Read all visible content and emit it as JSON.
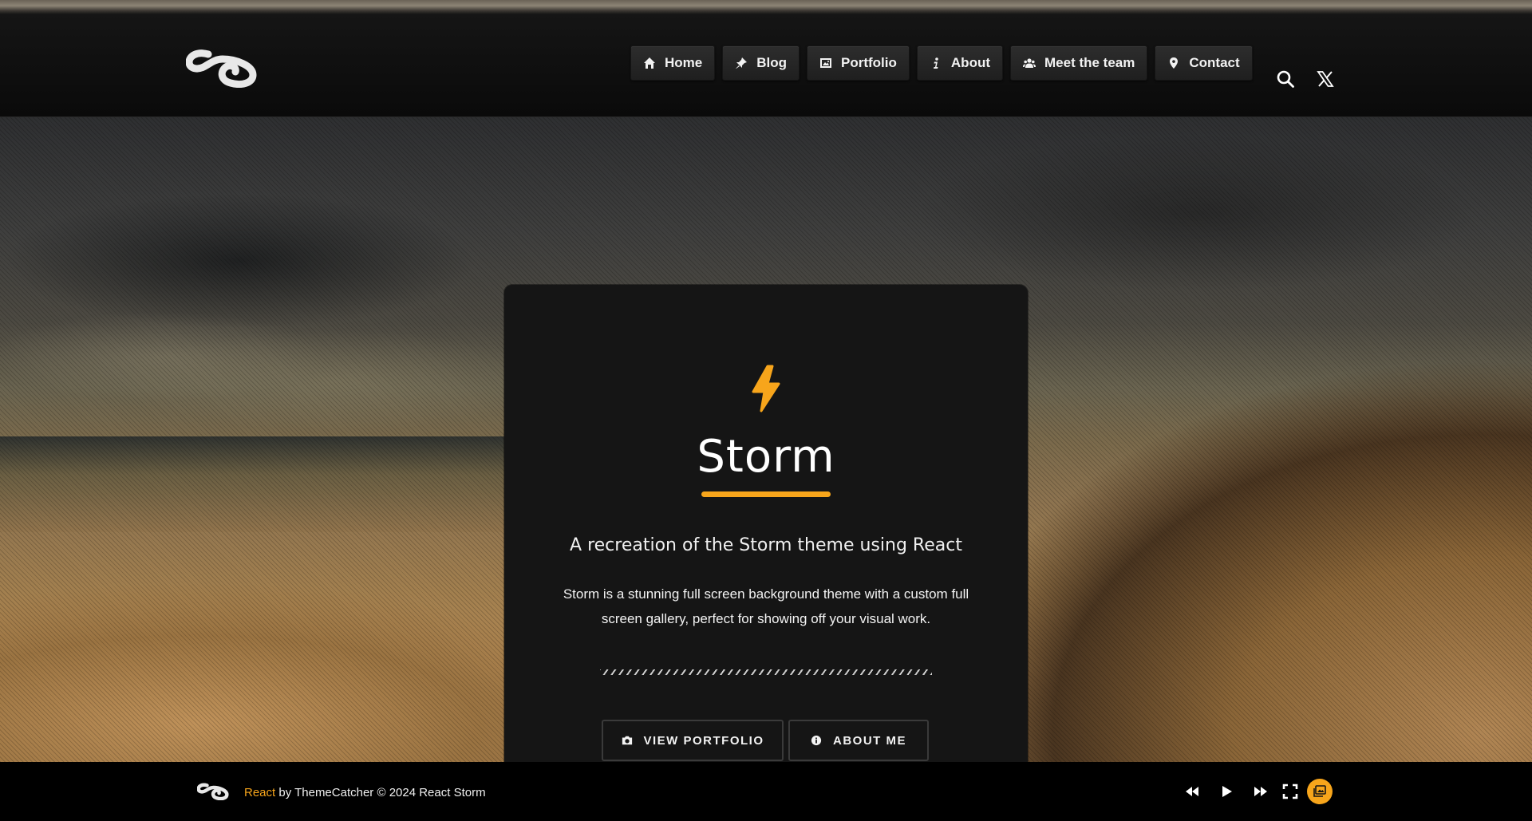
{
  "nav": {
    "items": [
      {
        "label": "Home",
        "icon": "home-icon"
      },
      {
        "label": "Blog",
        "icon": "pin-icon"
      },
      {
        "label": "Portfolio",
        "icon": "image-icon"
      },
      {
        "label": "About",
        "icon": "info-icon"
      },
      {
        "label": "Meet the team",
        "icon": "users-icon"
      },
      {
        "label": "Contact",
        "icon": "location-pin-icon"
      }
    ],
    "search_icon": "search-icon",
    "social_icon": "x-icon"
  },
  "hero": {
    "icon": "lightning-bolt-icon",
    "title": "Storm",
    "subtitle": "A recreation of the Storm theme using React",
    "description": "Storm is a stunning full screen background theme with a custom full screen gallery, perfect for showing off your visual work.",
    "buttons": {
      "portfolio": {
        "label": "VIEW PORTFOLIO",
        "icon": "camera-icon"
      },
      "about": {
        "label": "ABOUT ME",
        "icon": "info-circle-icon"
      }
    }
  },
  "footer": {
    "link": "React",
    "text": " by ThemeCatcher © 2024 React Storm",
    "controls": [
      "previous-icon",
      "play-icon",
      "next-icon",
      "fullscreen-icon",
      "gallery-icon"
    ]
  },
  "colors": {
    "accent": "#f7a51b",
    "card_bg": "#151515",
    "header_bg": "#0e0e0e",
    "footer_bg": "#000000",
    "text": "#ffffff"
  }
}
